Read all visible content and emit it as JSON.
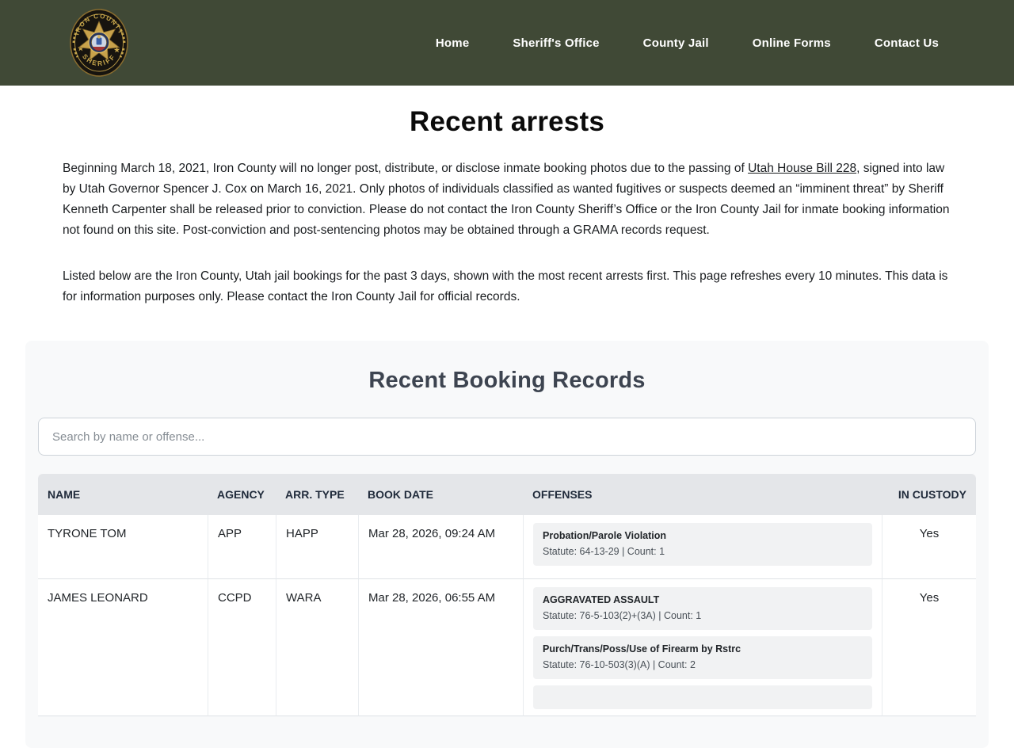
{
  "header": {
    "logo": {
      "top_text": "IRON COUNTY",
      "bottom_text": "SHERIFF"
    },
    "nav": {
      "home": "Home",
      "sheriffs_office": "Sheriff's Office",
      "county_jail": "County Jail",
      "online_forms": "Online Forms",
      "contact_us": "Contact Us"
    }
  },
  "page": {
    "title": "Recent arrests",
    "intro": {
      "before_link": "Beginning March 18, 2021, Iron County will no longer post, distribute, or disclose inmate booking photos due to the passing of ",
      "link_text": "Utah House Bill 228",
      "after_link": ", signed into law by Utah Governor Spencer J. Cox on March 16, 2021. Only photos of individuals classified as wanted fugitives or suspects deemed an “imminent threat” by Sheriff Kenneth Carpenter shall be released prior to conviction. Please do not contact the Iron County Sheriff’s Office or the Iron County Jail for inmate booking information not found on this site. Post-conviction and post-sentencing photos may be obtained through a GRAMA records request."
    },
    "second_paragraph": "Listed below are the Iron County, Utah jail bookings for the past 3 days, shown with the most recent arrests first. This page refreshes every 10 minutes. This data is for information purposes only. Please contact the Iron County Jail for official records."
  },
  "booking_section": {
    "title": "Recent Booking Records",
    "search_placeholder": "Search by name or offense...",
    "table": {
      "headers": [
        "NAME",
        "AGENCY",
        "ARR. TYPE",
        "BOOK DATE",
        "OFFENSES",
        "IN CUSTODY"
      ],
      "rows": [
        {
          "name": "TYRONE TOM",
          "agency": "APP",
          "arr_type": "HAPP",
          "book_date": "Mar 28, 2026, 09:24 AM",
          "in_custody": "Yes",
          "offenses": [
            {
              "title": "Probation/Parole Violation",
              "statute": "Statute: 64-13-29 | Count: 1"
            }
          ]
        },
        {
          "name": "JAMES LEONARD",
          "agency": "CCPD",
          "arr_type": "WARA",
          "book_date": "Mar 28, 2026, 06:55 AM",
          "in_custody": "Yes",
          "offenses": [
            {
              "title": "AGGRAVATED ASSAULT",
              "statute": "Statute: 76-5-103(2)+(3A) | Count: 1"
            },
            {
              "title": "Purch/Trans/Poss/Use of Firearm by Rstrc",
              "statute": "Statute: 76-10-503(3)(A) | Count: 2"
            }
          ]
        }
      ]
    }
  },
  "colors": {
    "header_bg": "#404936",
    "nav_text": "#ffffff",
    "section_bg": "#f8f9fa",
    "table_header_bg": "#e4e6e9",
    "table_header_text": "#1f2a3a",
    "offense_box_bg": "#f1f2f3",
    "border_color": "#dee2e6",
    "h2_color": "#3d4450",
    "badge_gold": "#c9a84c"
  }
}
